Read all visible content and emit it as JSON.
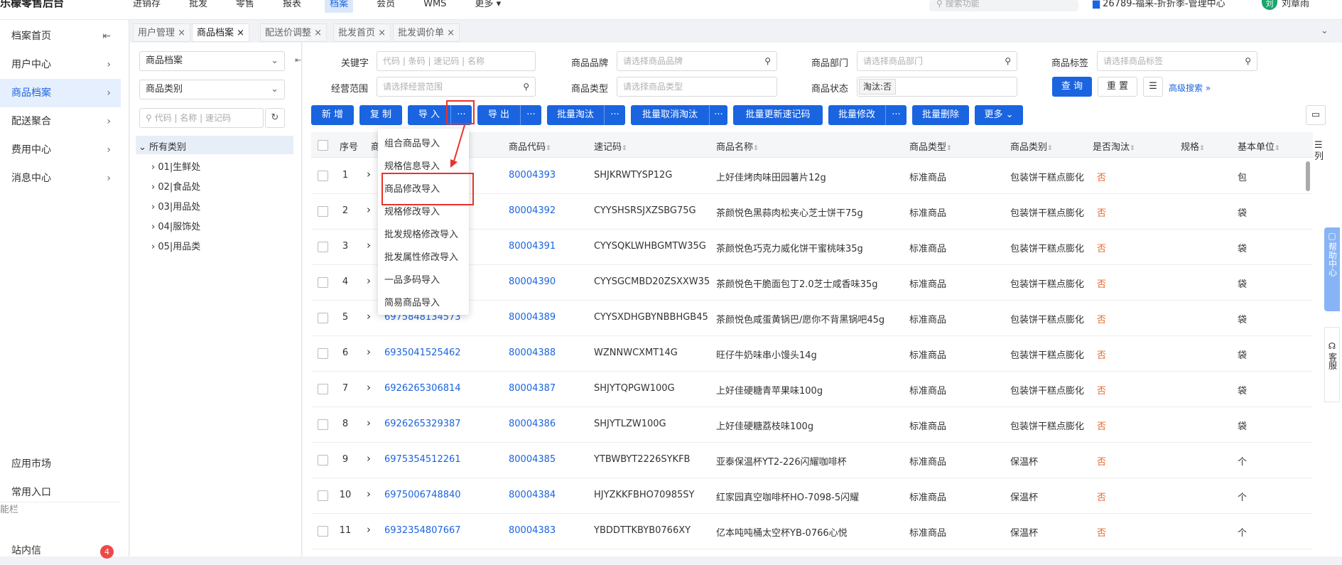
{
  "top": {
    "brand": "乐檬零售后台",
    "nav": [
      "进销存",
      "批发",
      "零售",
      "报表",
      "档案",
      "会员",
      "WMS",
      "更多"
    ],
    "active_nav": "档案",
    "search_placeholder": "搜索功能",
    "store": "26789-福来-折折季-管理中心",
    "user": "刘章雨",
    "avatar": "刘"
  },
  "sidebar": {
    "items": [
      {
        "label": "档案首页",
        "icon": "collapse-icon"
      },
      {
        "label": "用户中心"
      },
      {
        "label": "商品档案"
      },
      {
        "label": "配送聚合"
      },
      {
        "label": "费用中心"
      },
      {
        "label": "消息中心"
      }
    ],
    "bottom": [
      "应用市场",
      "常用入口"
    ],
    "section": "能栏",
    "inbox": "站内信",
    "inbox_badge": "4"
  },
  "tabs": [
    "用户管理",
    "商品档案",
    "配送价调整",
    "批发首页",
    "批发调价单"
  ],
  "tree": {
    "select1": "商品档案",
    "select2": "商品类别",
    "search_placeholder": "代码 | 名称 | 速记码",
    "root": "所有类别",
    "nodes": [
      "01|生鲜处",
      "02|食品处",
      "03|用品处",
      "04|服饰处",
      "05|用品类"
    ]
  },
  "filters": {
    "keyword_label": "关键字",
    "keyword_ph": "代码 | 条码 | 速记码 | 名称",
    "brand_label": "商品品牌",
    "brand_ph": "请选择商品品牌",
    "dept_label": "商品部门",
    "dept_ph": "请选择商品部门",
    "tag_label": "商品标签",
    "tag_ph": "请选择商品标签",
    "scope_label": "经营范围",
    "scope_ph": "请选择经营范围",
    "type_label": "商品类型",
    "type_ph": "请选择商品类型",
    "status_label": "商品状态",
    "status_tag": "淘汰:否",
    "query": "查 询",
    "reset": "重 置",
    "advanced": "高级搜索"
  },
  "toolbar": {
    "add": "新 增",
    "copy": "复 制",
    "import": "导 入",
    "export": "导 出",
    "batch_obsolete": "批量淘汰",
    "batch_cancel": "批量取消淘汰",
    "batch_update_code": "批量更新速记码",
    "batch_modify": "批量修改",
    "batch_delete": "批量删除",
    "more": "更多",
    "dots": "···"
  },
  "dropdown": [
    "组合商品导入",
    "规格信息导入",
    "商品修改导入",
    "规格修改导入",
    "批发规格修改导入",
    "批发属性修改导入",
    "一品多码导入",
    "简易商品导入"
  ],
  "columns": [
    "序号",
    "商",
    "商品代码",
    "速记码",
    "商品名称",
    "商品类型",
    "商品类别",
    "是否淘汰",
    "规格",
    "基本单位"
  ],
  "column_toggle": "列",
  "rows": [
    {
      "no": "1",
      "barcode": "",
      "code": "80004393",
      "quick": "SHJKRWTYSP12G",
      "name": "上好佳烤肉味田园薯片12g",
      "type": "标准商品",
      "cat": "包装饼干糕点膨化",
      "obsolete": "否",
      "unit": "包"
    },
    {
      "no": "2",
      "barcode": "",
      "code": "80004392",
      "quick": "CYYSHSRSJXZSBG75G",
      "name": "茶颜悦色黑蒜肉松夹心芝士饼干75g",
      "type": "标准商品",
      "cat": "包装饼干糕点膨化",
      "obsolete": "否",
      "unit": "袋"
    },
    {
      "no": "3",
      "barcode": "",
      "code": "80004391",
      "quick": "CYYSQKLWHBGMTW35G",
      "name": "茶颜悦色巧克力威化饼干蜜桃味35g",
      "type": "标准商品",
      "cat": "包装饼干糕点膨化",
      "obsolete": "否",
      "unit": "袋"
    },
    {
      "no": "4",
      "barcode": "",
      "code": "80004390",
      "quick": "CYYSGCMBD20ZSXXW35",
      "name": "茶颜悦色干脆面包丁2.0芝士咸香味35g",
      "type": "标准商品",
      "cat": "包装饼干糕点膨化",
      "obsolete": "否",
      "unit": "袋"
    },
    {
      "no": "5",
      "barcode": "6975848134573",
      "code": "80004389",
      "quick": "CYYSXDHGBYNBBHGB45",
      "name": "茶颜悦色咸蛋黄锅巴/愿你不背黑锅吧45g",
      "type": "标准商品",
      "cat": "包装饼干糕点膨化",
      "obsolete": "否",
      "unit": "袋"
    },
    {
      "no": "6",
      "barcode": "6935041525462",
      "code": "80004388",
      "quick": "WZNNWCXMT14G",
      "name": "旺仔牛奶味串小馒头14g",
      "type": "标准商品",
      "cat": "包装饼干糕点膨化",
      "obsolete": "否",
      "unit": "袋"
    },
    {
      "no": "7",
      "barcode": "6926265306814",
      "code": "80004387",
      "quick": "SHJYTQPGW100G",
      "name": "上好佳硬糖青苹果味100g",
      "type": "标准商品",
      "cat": "包装饼干糕点膨化",
      "obsolete": "否",
      "unit": "袋"
    },
    {
      "no": "8",
      "barcode": "6926265329387",
      "code": "80004386",
      "quick": "SHJYTLZW100G",
      "name": "上好佳硬糖荔枝味100g",
      "type": "标准商品",
      "cat": "包装饼干糕点膨化",
      "obsolete": "否",
      "unit": "袋"
    },
    {
      "no": "9",
      "barcode": "6975354512261",
      "code": "80004385",
      "quick": "YTBWBYT2226SYKFB",
      "name": "亚泰保温杯YT2-226闪耀咖啡杯",
      "type": "标准商品",
      "cat": "保温杯",
      "obsolete": "否",
      "unit": "个"
    },
    {
      "no": "10",
      "barcode": "6975006748840",
      "code": "80004384",
      "quick": "HJYZKKFBHO70985SY",
      "name": "红家园真空咖啡杯HO-7098-5闪耀",
      "type": "标准商品",
      "cat": "保温杯",
      "obsolete": "否",
      "unit": "个"
    },
    {
      "no": "11",
      "barcode": "6932354807667",
      "code": "80004383",
      "quick": "YBDDTTKBYB0766XY",
      "name": "亿本吨吨桶太空杯YB-0766心悦",
      "type": "标准商品",
      "cat": "保温杯",
      "obsolete": "否",
      "unit": "个"
    }
  ],
  "help": "帮助中心",
  "service": "客服"
}
